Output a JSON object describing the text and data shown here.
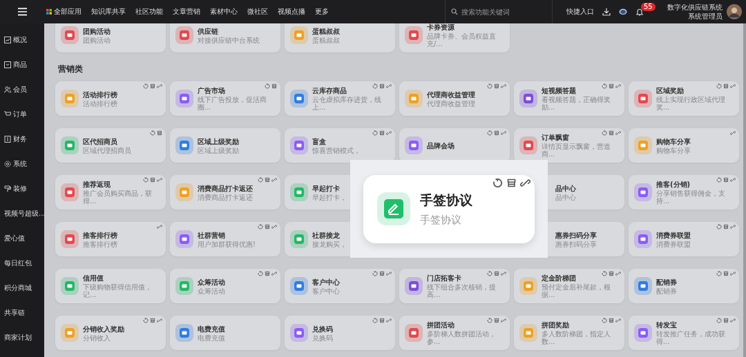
{
  "topbar": {
    "nav": [
      "全部应用",
      "知识库共享",
      "社区功能",
      "文章营销",
      "素材中心",
      "微社区",
      "视频点播",
      "更多"
    ],
    "search": {
      "placeholder": "搜索功能关键词"
    },
    "quick_entry": "快捷入口",
    "notifications": "55",
    "user": {
      "org": "数字化供应链系统",
      "role": "系统管理员"
    }
  },
  "sidebar": {
    "items": [
      {
        "label": "概况"
      },
      {
        "label": "商品"
      },
      {
        "label": "会员"
      },
      {
        "label": "订单"
      },
      {
        "label": "财务"
      },
      {
        "label": "系统"
      },
      {
        "label": "装修"
      },
      {
        "label": "视频号超级..."
      },
      {
        "label": "爱心值"
      },
      {
        "label": "每日红包"
      },
      {
        "label": "积分商城"
      },
      {
        "label": "共享链"
      },
      {
        "label": "商家计划"
      }
    ]
  },
  "top_cards": [
    {
      "kind": "card",
      "title": "团购活动",
      "desc": "团购活动",
      "color": "#e5484d"
    },
    {
      "kind": "card",
      "title": "供应链",
      "desc": "对接供应链中台系统",
      "color": "#e5484d"
    },
    {
      "kind": "card",
      "title": "蛋糕叔叔",
      "desc": "蛋糕叔叔",
      "color": "#f0a020"
    },
    {
      "kind": "card",
      "title": "卡券资源",
      "desc": "品牌卡券、会员权益直充/...",
      "color": "#e5484d"
    }
  ],
  "section": {
    "title": "营销类",
    "cards": [
      {
        "kind": "card",
        "title": "活动排行榜",
        "desc": "活动排行榜",
        "color": "#f0a020",
        "sync": true,
        "store": true,
        "link": true
      },
      {
        "kind": "card",
        "title": "广告市场",
        "desc": "线下广告投放，促活商圈...",
        "color": "#8b5cf6",
        "sync": true,
        "store": true
      },
      {
        "kind": "card",
        "title": "云库存商品",
        "desc": "云仓虚拟库存进货，线上...",
        "color": "#2f7de1",
        "sync": true,
        "store": true,
        "link": true
      },
      {
        "kind": "card",
        "title": "代理商收益管理",
        "desc": "代理商收益管理",
        "color": "#f0a020",
        "sync": true,
        "store": true,
        "link": true
      },
      {
        "kind": "card",
        "title": "短视频答题",
        "desc": "看视频答题，正确得奖励...",
        "color": "#7c4ddc",
        "sync": true,
        "store": true,
        "link": true
      },
      {
        "kind": "card",
        "title": "区域奖励",
        "desc": "线上实现行政区域代理奖...",
        "color": "#e5484d",
        "sync": true,
        "store": true,
        "link": true
      },
      {
        "kind": "card",
        "title": "区代招商员",
        "desc": "区域代理招商员",
        "color": "#22b866",
        "sync": true,
        "store": true
      },
      {
        "kind": "card",
        "title": "区域上级奖励",
        "desc": "区域上级奖励",
        "color": "#2f7de1"
      },
      {
        "kind": "card",
        "title": "盲盒",
        "desc": "惊喜营销模式，",
        "color": "#8b5cf6",
        "sync": true,
        "store": true,
        "link": true
      },
      {
        "kind": "card",
        "title": "品牌会场",
        "color": "#8b5cf6",
        "sync": true,
        "store": true,
        "link": true
      },
      {
        "kind": "card",
        "title": "订单飘窗",
        "desc": "详情页显示飘窗，营造商...",
        "color": "#e5484d",
        "sync": true,
        "store": true,
        "link": true
      },
      {
        "kind": "card",
        "title": "购物车分享",
        "desc": "购物车分享",
        "color": "#f0a020",
        "link": true
      },
      {
        "kind": "card",
        "title": "推荐返现",
        "desc": "推广会员购买商品，获得...",
        "color": "#e5484d",
        "sync": true,
        "store": true,
        "link": true
      },
      {
        "kind": "card",
        "title": "消费商品打卡返还",
        "desc": "消费商品打卡返还",
        "color": "#f0a020",
        "sync": true,
        "store": true,
        "link": true
      },
      {
        "kind": "card",
        "title": "早起打卡",
        "desc": "早起打卡，",
        "color": "#22b866"
      },
      {
        "kind": "hidden"
      },
      {
        "kind": "partial",
        "title": "品中心",
        "desc": "品中心"
      },
      {
        "kind": "card",
        "title": "推客(分销)",
        "desc": "分享销售获得佣金，支持...",
        "color": "#8b5cf6",
        "sync": true,
        "store": true,
        "link": true
      },
      {
        "kind": "card",
        "title": "推客排行榜",
        "desc": "推客排行榜",
        "color": "#e5484d",
        "link": true
      },
      {
        "kind": "card",
        "title": "社群营销",
        "desc": "用户加群获得优惠!",
        "color": "#8b5cf6",
        "sync": true,
        "store": true,
        "link": true
      },
      {
        "kind": "card",
        "title": "社群接龙",
        "desc": "接龙购买，",
        "color": "#22b866"
      },
      {
        "kind": "hidden"
      },
      {
        "kind": "partial",
        "title": "惠券扫码分享",
        "desc": "惠券扫码分享"
      },
      {
        "kind": "card",
        "title": "消费券联盟",
        "desc": "消费券联盟",
        "color": "#8b5cf6",
        "sync": true,
        "store": true,
        "link": true
      },
      {
        "kind": "card",
        "title": "信用值",
        "desc": "下级购物获得信用值，记...",
        "color": "#22b866"
      },
      {
        "kind": "card",
        "title": "众筹活动",
        "desc": "众筹活动",
        "color": "#22b866",
        "sync": true,
        "store": true,
        "link": true
      },
      {
        "kind": "card",
        "title": "客户中心",
        "desc": "客户中心",
        "color": "#2f7de1",
        "sync": true,
        "store": true,
        "link": true
      },
      {
        "kind": "card",
        "title": "门店拓客卡",
        "desc": "线下组合多次核销，提高...",
        "color": "#7c4ddc",
        "sync": true,
        "store": true,
        "link": true
      },
      {
        "kind": "card",
        "title": "定金阶梯团",
        "desc": "预付定金后补尾款，根据...",
        "color": "#f0a020",
        "sync": true,
        "store": true,
        "link": true
      },
      {
        "kind": "card",
        "title": "配销券",
        "desc": "配销券",
        "color": "#2f7de1",
        "sync": true,
        "store": true,
        "link": true
      },
      {
        "kind": "card",
        "title": "分销收入奖励",
        "desc": "分销收入",
        "color": "#f0a020",
        "sync": true,
        "store": true,
        "link": true
      },
      {
        "kind": "card",
        "title": "电费充值",
        "desc": "电费充值",
        "color": "#2f7de1"
      },
      {
        "kind": "card",
        "title": "兑换码",
        "desc": "兑换码",
        "color": "#8b5cf6",
        "sync": true,
        "store": true,
        "link": true
      },
      {
        "kind": "card",
        "title": "拼团活动",
        "desc": "多阶梯人数拼团活动，参...",
        "color": "#e5484d",
        "sync": true,
        "store": true,
        "link": true
      },
      {
        "kind": "card",
        "title": "拼团奖励",
        "desc": "多人数阶梯团，指定人数...",
        "color": "#f0a020",
        "sync": true,
        "store": true,
        "link": true
      },
      {
        "kind": "card",
        "title": "转发宝",
        "desc": "转发推广任务，成功获得...",
        "color": "#8b5cf6",
        "sync": true,
        "store": true,
        "link": true
      }
    ]
  },
  "popup": {
    "title": "手签协议",
    "desc": "手签协议",
    "color": "#1fbf6a",
    "sync": true,
    "store": true,
    "link": true
  }
}
